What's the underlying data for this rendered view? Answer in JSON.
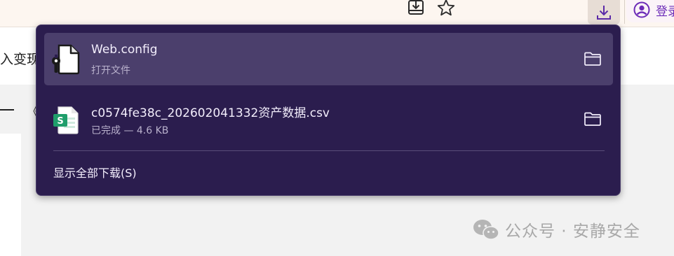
{
  "toolbar": {
    "install_icon": "install-app-icon",
    "bookmark_icon": "star-icon",
    "download_icon": "download-icon",
    "signin_icon": "account-circle-icon",
    "signin_label": "登录"
  },
  "page": {
    "partial_text": "入变现",
    "partial_symbol": "《",
    "watermark": "公众号 · 安静安全"
  },
  "downloads": {
    "items": [
      {
        "name": "Web.config",
        "status": "打开文件",
        "icon": "config-file-icon",
        "folder_icon": "folder-icon"
      },
      {
        "name": "c0574fe38c_202602041332资产数据.csv",
        "status": "已完成 — 4.6 KB",
        "icon": "csv-spreadsheet-icon",
        "folder_icon": "folder-icon"
      }
    ],
    "show_all": "显示全部下载(S)"
  },
  "colors": {
    "panel_bg": "#2b1d4e",
    "selected_item_bg": "#4b3f6c",
    "accent_purple": "#6c2bb7",
    "csv_green": "#1f9e6b"
  }
}
